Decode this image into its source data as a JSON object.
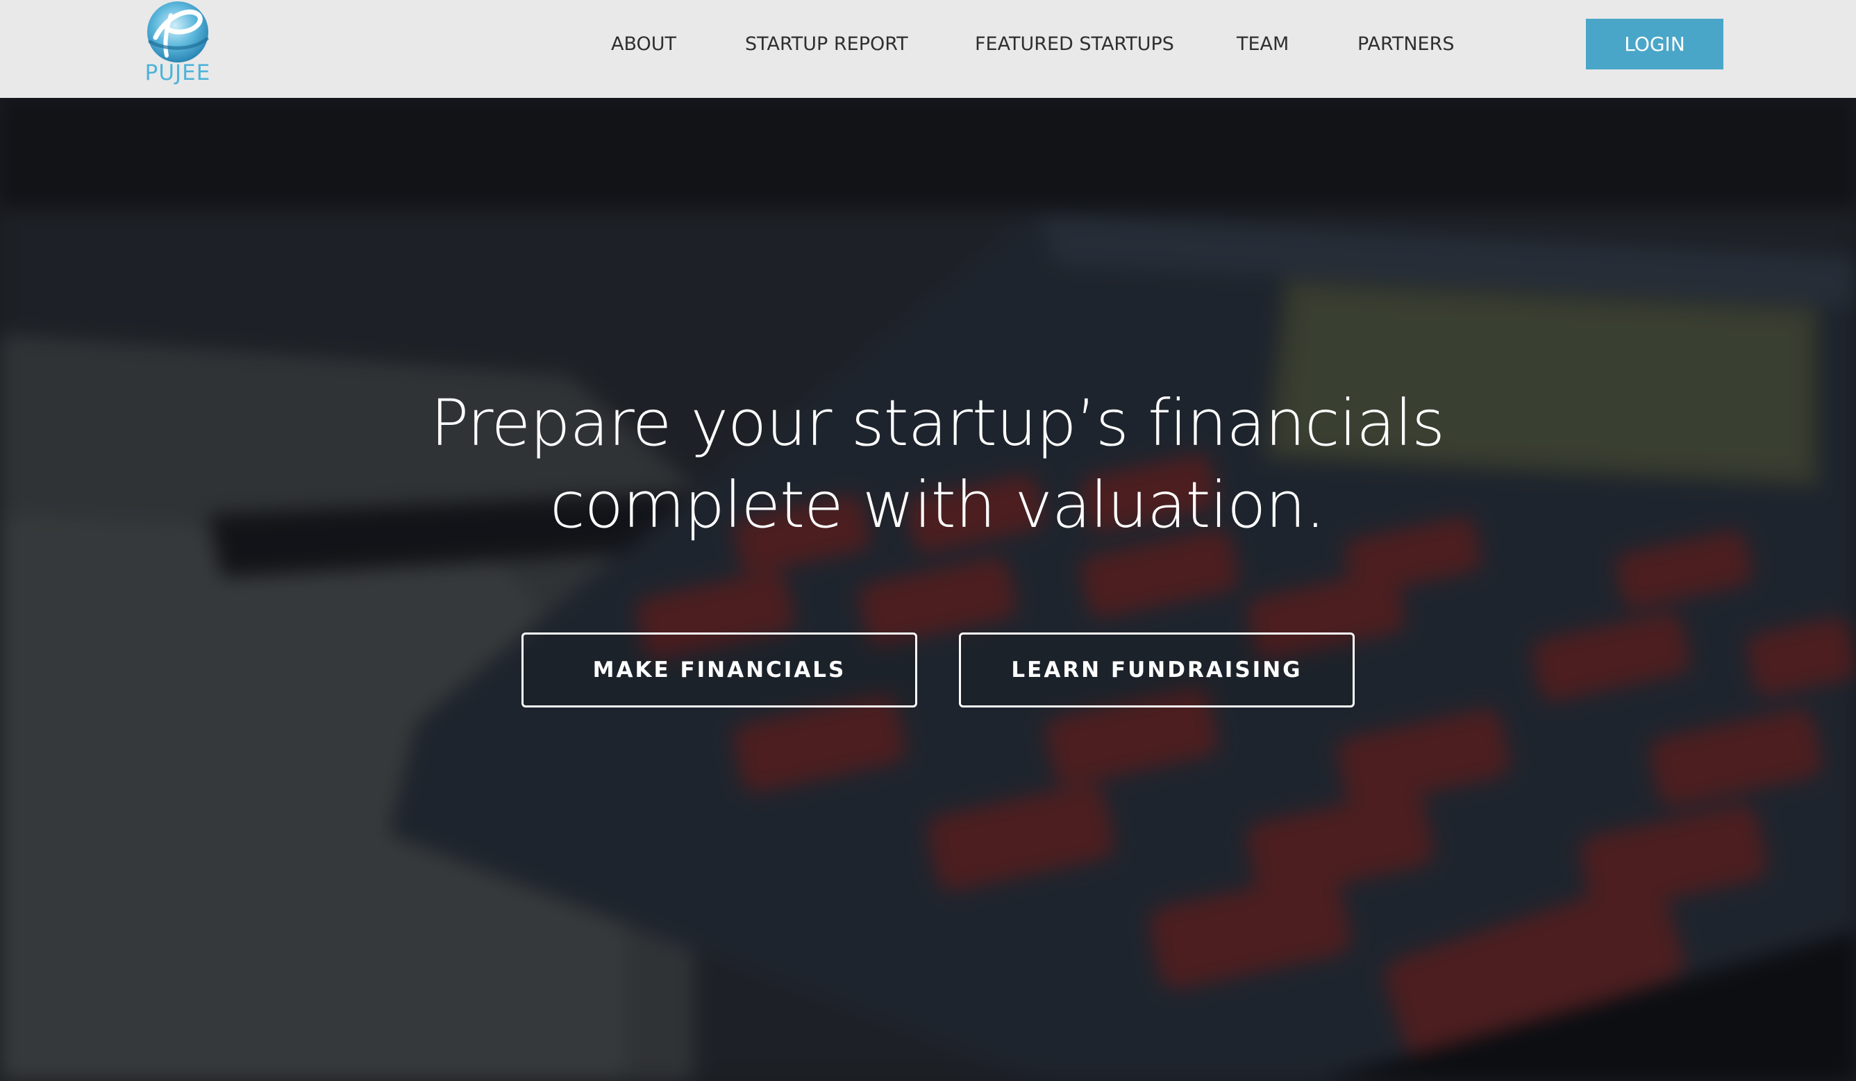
{
  "header": {
    "logo": {
      "text": "PUJEE",
      "icon": "pujee-logo-icon",
      "color": "#4fb3d9"
    },
    "nav": [
      {
        "label": "ABOUT"
      },
      {
        "label": "STARTUP REPORT"
      },
      {
        "label": "FEATURED STARTUPS"
      },
      {
        "label": "TEAM"
      },
      {
        "label": "PARTNERS"
      }
    ],
    "login_label": "LOGIN",
    "login_color": "#4aa6c8"
  },
  "hero": {
    "title_line1": "Prepare your startup’s financials",
    "title_line2": "complete with valuation.",
    "buttons": {
      "make_financials": "MAKE FINANCIALS",
      "learn_fundraising": "LEARN FUNDRAISING"
    },
    "background": "blurred-calculator-photo"
  }
}
